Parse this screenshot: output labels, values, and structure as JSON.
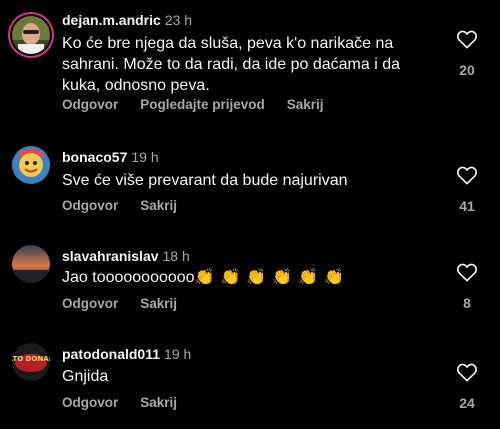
{
  "comments": [
    {
      "username": "dejan.m.andric",
      "time": "23 h",
      "text": "Ko će bre njega da sluša, peva k'o narikače na sahrani. Može to da radi, da ide po daćama i da kuka, odnosno peva.",
      "actions": [
        "Odgovor",
        "Pogledajte prijevod",
        "Sakrij"
      ],
      "likes": "20",
      "avatar_icon": "man-sunglasses-avatar"
    },
    {
      "username": "bonaco57",
      "time": "19 h",
      "text": "Sve će više prevarant da bude najurivan",
      "actions": [
        "Odgovor",
        "Sakrij"
      ],
      "likes": "41",
      "avatar_icon": "cartoon-avatar"
    },
    {
      "username": "slavahranislav",
      "time": "18 h",
      "text": "Jao tooooooooooo",
      "emojis": "👏👏👏👏👏👏",
      "actions": [
        "Odgovor",
        "Sakrij"
      ],
      "likes": "8",
      "avatar_icon": "sunset-avatar"
    },
    {
      "username": "patodonald011",
      "time": "19 h",
      "text": "Gnjida",
      "actions": [
        "Odgovor",
        "Sakrij"
      ],
      "likes": "24",
      "avatar_icon": "pato-donald-logo-avatar",
      "avatar_logo_text": "PATO DONALD"
    }
  ],
  "colors": {
    "background": "#000000",
    "text": "#f5f5f5",
    "secondary": "#a8a8a8",
    "story_ring": "#d63384"
  }
}
